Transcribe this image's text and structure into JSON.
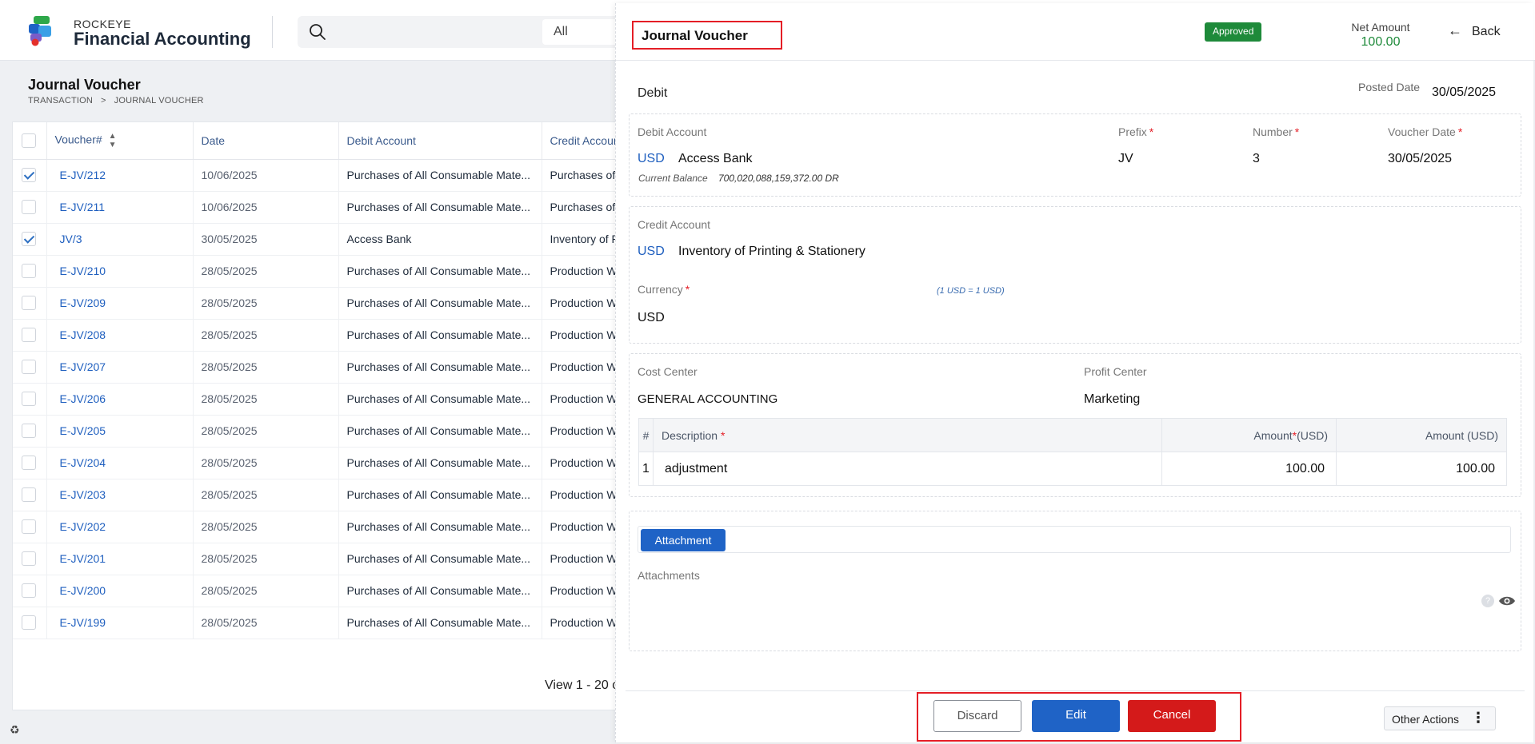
{
  "app": {
    "brand_small": "ROCKEYE",
    "brand_big": "Financial Accounting",
    "search_scope": "All"
  },
  "list": {
    "title": "Journal Voucher",
    "breadcrumb": [
      "TRANSACTION",
      "JOURNAL VOUCHER"
    ],
    "breadcrumb_sep": ">",
    "columns": [
      "Voucher#",
      "Date",
      "Debit Account",
      "Credit Accoun"
    ],
    "rows": [
      {
        "voucher": "E-JV/212",
        "date": "10/06/2025",
        "debit": "Purchases of All Consumable Mate...",
        "credit": "Purchases of A",
        "checked": true
      },
      {
        "voucher": "E-JV/211",
        "date": "10/06/2025",
        "debit": "Purchases of All Consumable Mate...",
        "credit": "Purchases of A",
        "checked": false
      },
      {
        "voucher": "JV/3",
        "date": "30/05/2025",
        "debit": "Access Bank",
        "credit": "Inventory of P",
        "checked": true
      },
      {
        "voucher": "E-JV/210",
        "date": "28/05/2025",
        "debit": "Purchases of All Consumable Mate...",
        "credit": "Production W",
        "checked": false
      },
      {
        "voucher": "E-JV/209",
        "date": "28/05/2025",
        "debit": "Purchases of All Consumable Mate...",
        "credit": "Production W",
        "checked": false
      },
      {
        "voucher": "E-JV/208",
        "date": "28/05/2025",
        "debit": "Purchases of All Consumable Mate...",
        "credit": "Production W",
        "checked": false
      },
      {
        "voucher": "E-JV/207",
        "date": "28/05/2025",
        "debit": "Purchases of All Consumable Mate...",
        "credit": "Production W",
        "checked": false
      },
      {
        "voucher": "E-JV/206",
        "date": "28/05/2025",
        "debit": "Purchases of All Consumable Mate...",
        "credit": "Production W",
        "checked": false
      },
      {
        "voucher": "E-JV/205",
        "date": "28/05/2025",
        "debit": "Purchases of All Consumable Mate...",
        "credit": "Production W",
        "checked": false
      },
      {
        "voucher": "E-JV/204",
        "date": "28/05/2025",
        "debit": "Purchases of All Consumable Mate...",
        "credit": "Production W",
        "checked": false
      },
      {
        "voucher": "E-JV/203",
        "date": "28/05/2025",
        "debit": "Purchases of All Consumable Mate...",
        "credit": "Production W",
        "checked": false
      },
      {
        "voucher": "E-JV/202",
        "date": "28/05/2025",
        "debit": "Purchases of All Consumable Mate...",
        "credit": "Production W",
        "checked": false
      },
      {
        "voucher": "E-JV/201",
        "date": "28/05/2025",
        "debit": "Purchases of All Consumable Mate...",
        "credit": "Production W",
        "checked": false
      },
      {
        "voucher": "E-JV/200",
        "date": "28/05/2025",
        "debit": "Purchases of All Consumable Mate...",
        "credit": "Production W",
        "checked": false
      },
      {
        "voucher": "E-JV/199",
        "date": "28/05/2025",
        "debit": "Purchases of All Consumable Mate...",
        "credit": "Production W",
        "checked": false
      }
    ],
    "footer": "View 1 - 20 o"
  },
  "panel": {
    "title": "Journal Voucher",
    "status": "Approved",
    "net_amount_label": "Net Amount",
    "net_amount_value": "100.00",
    "back_label": "Back",
    "debit_section_title": "Debit",
    "posted_date_label": "Posted Date",
    "posted_date_value": "30/05/2025",
    "debit": {
      "account_label": "Debit Account",
      "currency": "USD",
      "account": "Access Bank",
      "balance_label": "Current Balance",
      "balance_value": "700,020,088,159,372.00 DR",
      "prefix_label": "Prefix",
      "prefix_value": "JV",
      "number_label": "Number",
      "number_value": "3",
      "voucher_date_label": "Voucher Date",
      "voucher_date_value": "30/05/2025"
    },
    "credit": {
      "account_label": "Credit Account",
      "currency": "USD",
      "account": "Inventory of Printing & Stationery",
      "currency_label": "Currency",
      "rate_note": "(1 USD = 1 USD)",
      "currency_value": "USD"
    },
    "centers": {
      "cost_label": "Cost Center",
      "cost_value": "GENERAL ACCOUNTING",
      "profit_label": "Profit Center",
      "profit_value": "Marketing"
    },
    "lines": {
      "headers": {
        "num": "#",
        "description": "Description",
        "amount_req": "Amount",
        "amount_req_unit": "(USD)",
        "amount": "Amount (USD)"
      },
      "rows": [
        {
          "num": "1",
          "description": "adjustment",
          "amount_req": "100.00",
          "amount": "100.00"
        }
      ]
    },
    "attachment_button": "Attachment",
    "attachments_label": "Attachments",
    "buttons": {
      "discard": "Discard",
      "edit": "Edit",
      "cancel": "Cancel",
      "other": "Other Actions"
    }
  },
  "colors": {
    "accent": "#1f63c6",
    "approved": "#1e8a3a",
    "danger": "#d41a1a",
    "highlight": "#e41e26"
  }
}
